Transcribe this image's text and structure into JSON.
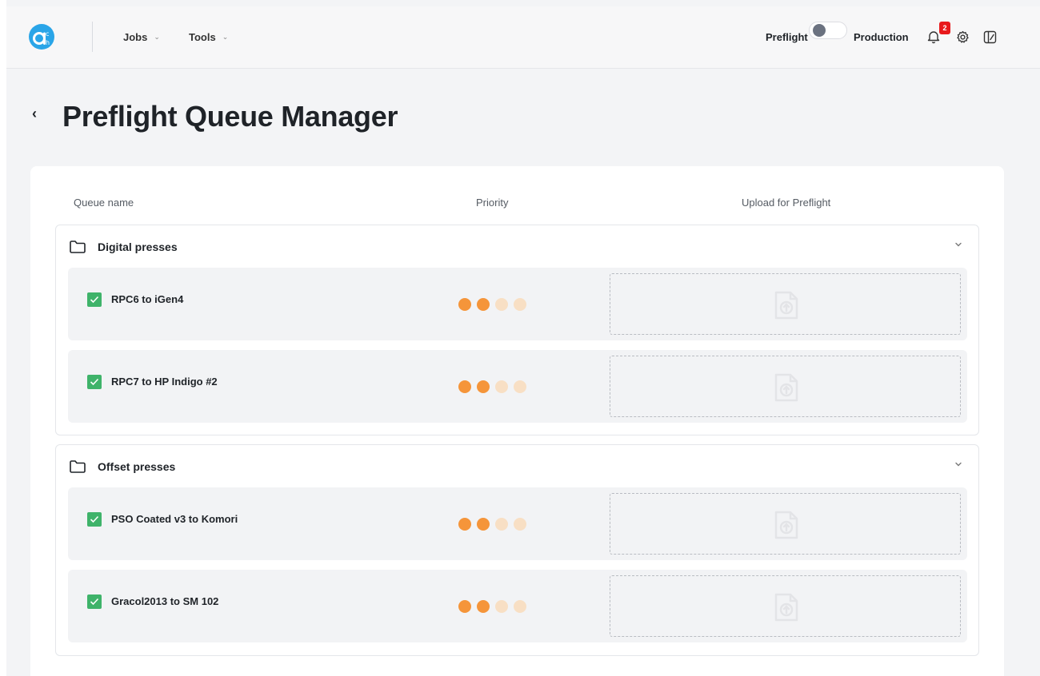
{
  "nav": {
    "jobs_label": "Jobs",
    "tools_label": "Tools",
    "mode_left": "Preflight",
    "mode_right": "Production",
    "notification_count": "2"
  },
  "page": {
    "title": "Preflight Queue Manager"
  },
  "table": {
    "col_queue": "Queue name",
    "col_priority": "Priority",
    "col_upload": "Upload for Preflight"
  },
  "groups": [
    {
      "title": "Digital presses",
      "rows": [
        {
          "name": "RPC6 to iGen4",
          "priority": 2,
          "priority_max": 4,
          "checked": true
        },
        {
          "name": "RPC7 to HP Indigo #2",
          "priority": 2,
          "priority_max": 4,
          "checked": true
        }
      ]
    },
    {
      "title": "Offset presses",
      "rows": [
        {
          "name": "PSO Coated v3 to Komori",
          "priority": 2,
          "priority_max": 4,
          "checked": true
        },
        {
          "name": "Gracol2013 to SM 102",
          "priority": 2,
          "priority_max": 4,
          "checked": true
        }
      ]
    }
  ],
  "colors": {
    "accent": "#2aa5e8",
    "checkbox": "#3fb36a",
    "priority_on": "#f5953a",
    "priority_off": "#f8dfc4",
    "badge": "#e8191c"
  },
  "icons": {
    "logo": "ach-logo",
    "bell": "bell-icon",
    "settings": "gear-icon",
    "panel": "panel-toggle-icon",
    "folder": "folder-icon",
    "upload": "file-upload-icon"
  }
}
